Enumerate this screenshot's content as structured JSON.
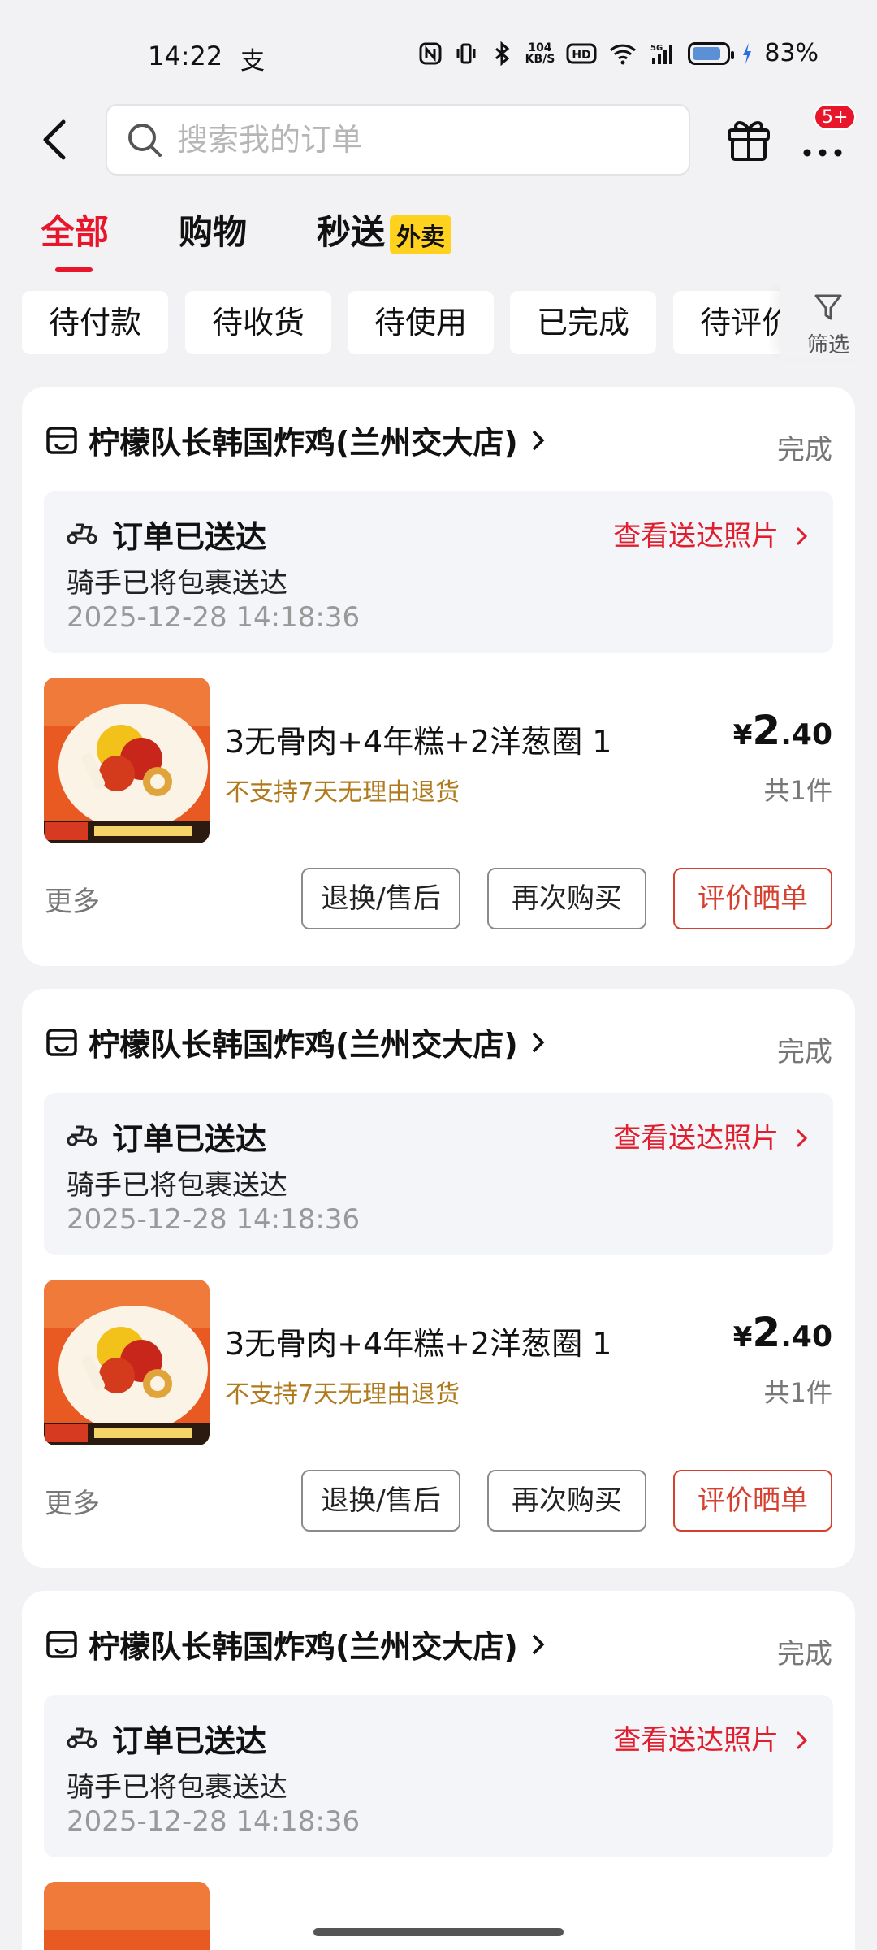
{
  "status_bar": {
    "time": "14:22",
    "alipay_glyph": "支",
    "speed_top": "104",
    "speed_bottom": "KB/S",
    "battery": "83%",
    "battery_level": 0.83
  },
  "header": {
    "search_placeholder": "搜索我的订单",
    "more_badge": "5+"
  },
  "tabs": [
    {
      "label": "全部",
      "active": true
    },
    {
      "label": "购物",
      "active": false
    },
    {
      "label": "秒送",
      "badge": "外卖",
      "active": false
    }
  ],
  "chips": [
    "待付款",
    "待收货",
    "待使用",
    "已完成",
    "待评价"
  ],
  "filter_label": "筛选",
  "orders": [
    {
      "store": "柠檬队长韩国炸鸡(兰州交大店)",
      "status": "完成",
      "delivery_title": "订单已送达",
      "view_photo": "查看送达照片",
      "delivery_sub": "骑手已将包裹送达",
      "delivery_time": "2025-12-28 14:18:36",
      "product_title": "3无骨肉+4年糕+2洋葱圈 1",
      "product_note": "不支持7天无理由退货",
      "price_currency": "¥",
      "price_int": "2",
      "price_dec": ".40",
      "qty": "共1件",
      "more": "更多",
      "btn_return": "退换/售后",
      "btn_rebuy": "再次购买",
      "btn_review": "评价晒单"
    },
    {
      "store": "柠檬队长韩国炸鸡(兰州交大店)",
      "status": "完成",
      "delivery_title": "订单已送达",
      "view_photo": "查看送达照片",
      "delivery_sub": "骑手已将包裹送达",
      "delivery_time": "2025-12-28 14:18:36",
      "product_title": "3无骨肉+4年糕+2洋葱圈 1",
      "product_note": "不支持7天无理由退货",
      "price_currency": "¥",
      "price_int": "2",
      "price_dec": ".40",
      "qty": "共1件",
      "more": "更多",
      "btn_return": "退换/售后",
      "btn_rebuy": "再次购买",
      "btn_review": "评价晒单"
    },
    {
      "store": "柠檬队长韩国炸鸡(兰州交大店)",
      "status": "完成",
      "delivery_title": "订单已送达",
      "view_photo": "查看送达照片",
      "delivery_sub": "骑手已将包裹送达",
      "delivery_time": "2025-12-28 14:18:36"
    }
  ],
  "colors": {
    "accent_red": "#e8152b",
    "link_red": "#e01e2d",
    "note_gold": "#b07a1e",
    "tab_badge": "#ffd21f",
    "page_bg": "#f2f2f5"
  },
  "icons": [
    "back-arrow-icon",
    "search-icon",
    "gift-icon",
    "more-dots-icon",
    "filter-funnel-icon",
    "store-icon",
    "scooter-icon",
    "chevron-right-icon"
  ]
}
